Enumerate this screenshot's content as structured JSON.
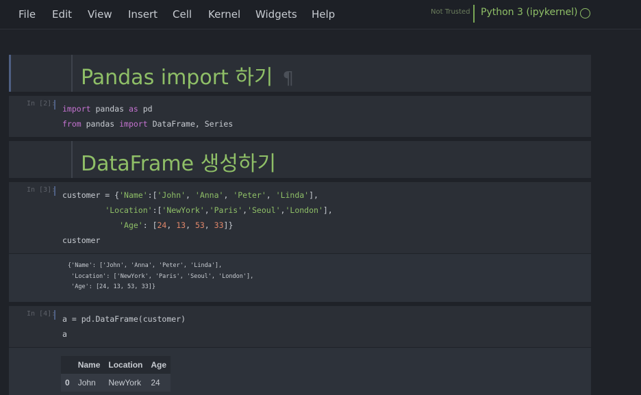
{
  "menubar": {
    "items": [
      "File",
      "Edit",
      "View",
      "Insert",
      "Cell",
      "Kernel",
      "Widgets",
      "Help"
    ],
    "trust_status": "Not Trusted",
    "kernel_name": "Python 3 (ipykernel)"
  },
  "cells": {
    "md1": {
      "heading": "Pandas import 하기",
      "anchor": "¶"
    },
    "code1": {
      "prompt": "In [2]:"
    },
    "md2": {
      "heading": "DataFrame 생성하기"
    },
    "code2": {
      "prompt": "In [3]:"
    },
    "out2": {
      "lines": [
        "{'Name': ['John', 'Anna', 'Peter', 'Linda'],",
        " 'Location': ['NewYork', 'Paris', 'Seoul', 'London'],",
        " 'Age': [24, 13, 53, 33]}"
      ]
    },
    "code3": {
      "prompt": "In [4]:"
    },
    "out3": {
      "columns": [
        "Name",
        "Location",
        "Age"
      ],
      "rows": [
        {
          "index": "0",
          "name": "John",
          "location": "NewYork",
          "age": "24"
        }
      ]
    }
  },
  "colors": {
    "heading": "#8fbf67",
    "keyword": "#c573d1",
    "string": "#8fbf67",
    "number": "#e0876a",
    "background": "#1f2228",
    "cell": "#2b2f36"
  }
}
